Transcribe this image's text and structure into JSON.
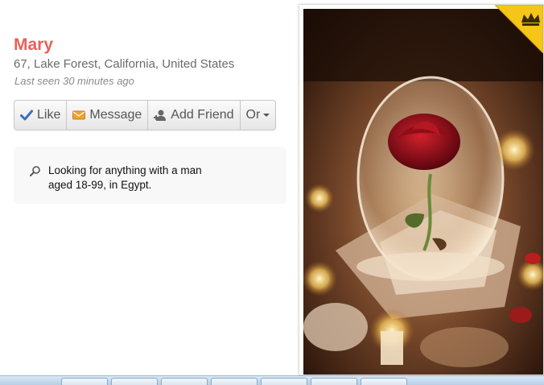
{
  "profile": {
    "name": "Mary",
    "location": "67, Lake Forest, California, United States",
    "last_seen": "Last seen 30 minutes ago"
  },
  "actions": {
    "like": "Like",
    "message": "Message",
    "add_friend": "Add Friend",
    "or": "Or"
  },
  "seeking": {
    "text": "Looking for anything with a man aged 18-99, in Egypt."
  },
  "colors": {
    "name": "#e8605a",
    "like_icon": "#3a6fc4",
    "message_icon": "#f0a030",
    "badge": "#f5c518"
  },
  "icons": [
    "check-icon",
    "envelope-icon",
    "add-person-icon",
    "caret-down-icon",
    "magnifier-icon",
    "crown-icon"
  ]
}
